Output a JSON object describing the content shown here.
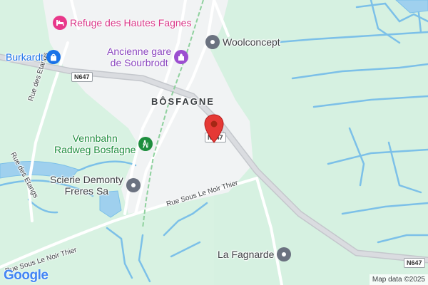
{
  "map": {
    "locality_label": "BÔSFAGNE",
    "road_shields": [
      "N647",
      "N647",
      "N647"
    ],
    "street_labels": {
      "rue_des_etangs_1": "Rue des Etangs",
      "rue_des_etangs_2": "Rue des Etangs",
      "rue_sous_le_noir_thier_1": "Rue Sous Le Noir Thier",
      "rue_sous_le_noir_thier_2": "Rue Sous Le Noir Thier"
    },
    "pois": {
      "refuge": {
        "label": "Refuge des Hautes Fagnes",
        "color": "#e8388a",
        "icon": "bed-icon"
      },
      "gare": {
        "label_line1": "Ancienne gare",
        "label_line2": "de Sourbrodt",
        "color": "#9c4fd0",
        "icon": "landmark-icon"
      },
      "woolconcept": {
        "label": "Woolconcept",
        "color": "#6b7280",
        "icon": "pin-dot-icon"
      },
      "burkardt": {
        "label": "Burkardt",
        "color": "#1a73e8",
        "icon": "shopping-bag-icon"
      },
      "vennbahn": {
        "label_line1": "Vennbahn",
        "label_line2": "Radweg Bosfagne",
        "color": "#1e8e3e",
        "icon": "hiking-icon"
      },
      "scierie": {
        "label_line1": "Scierie Demonty",
        "label_line2": "Freres Sa",
        "color": "#6b7280",
        "icon": "pin-dot-icon"
      },
      "fagnarde": {
        "label": "La Fagnarde",
        "color": "#6b7280",
        "icon": "pin-dot-icon"
      }
    },
    "marker_color": "#e53935"
  },
  "footer": {
    "logo": "Google",
    "attribution": "Map data ©2025"
  }
}
